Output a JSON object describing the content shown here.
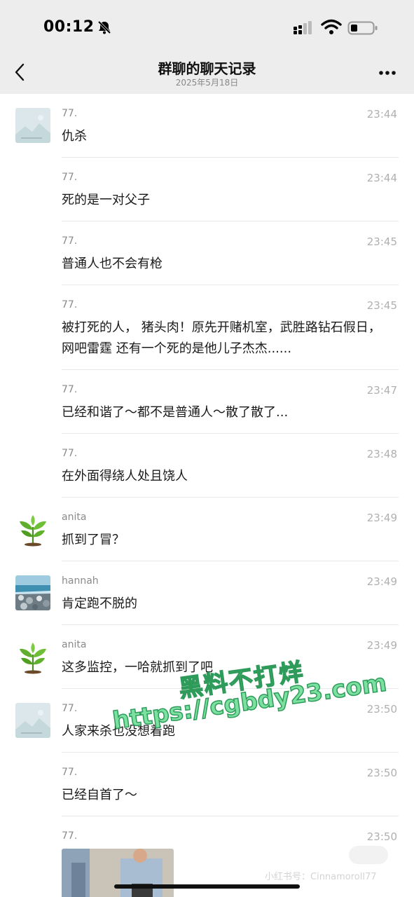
{
  "status_bar": {
    "time": "00:12",
    "bell_icon": "bell-slash-icon",
    "signal_icon": "signal-icon",
    "wifi_icon": "wifi-icon",
    "battery_icon": "battery-low-icon"
  },
  "header": {
    "back_icon": "chevron-left-icon",
    "title": "群聊的聊天记录",
    "date": "2025年5月18日",
    "more_icon": "more-dots-icon"
  },
  "messages": [
    {
      "sender": "77.",
      "time": "23:44",
      "text": "仇杀",
      "avatar": "placeholder",
      "show_avatar": true
    },
    {
      "sender": "77.",
      "time": "23:44",
      "text": "死的是一对父子",
      "show_avatar": false
    },
    {
      "sender": "77.",
      "time": "23:45",
      "text": "普通人也不会有枪",
      "show_avatar": false
    },
    {
      "sender": "77.",
      "time": "23:45",
      "text": "被打死的人， 猪头肉！原先开赌机室，武胜路钻石假日，网吧雷霆 还有一个死的是他儿子杰杰......",
      "show_avatar": false
    },
    {
      "sender": "77.",
      "time": "23:47",
      "text": "已经和谐了～都不是普通人～散了散了...",
      "show_avatar": false
    },
    {
      "sender": "77.",
      "time": "23:48",
      "text": "在外面得绕人处且饶人",
      "show_avatar": false
    },
    {
      "sender": "anita",
      "time": "23:49",
      "text": "抓到了冒？",
      "avatar": "plant",
      "show_avatar": true
    },
    {
      "sender": "hannah",
      "time": "23:49",
      "text": "肯定跑不脱的",
      "avatar": "landscape",
      "show_avatar": true
    },
    {
      "sender": "anita",
      "time": "23:49",
      "text": "这多监控，一哈就抓到了吧",
      "avatar": "plant",
      "show_avatar": true
    },
    {
      "sender": "77.",
      "time": "23:50",
      "text": "人家来杀也没想着跑",
      "avatar": "placeholder",
      "show_avatar": true
    },
    {
      "sender": "77.",
      "time": "23:50",
      "text": "已经自首了～",
      "show_avatar": false
    },
    {
      "sender": "77.",
      "time": "23:50",
      "text": "",
      "has_photo": true,
      "show_avatar": false
    }
  ],
  "watermark": {
    "line1": "黑料不打烊",
    "line2": "https://cgbdy23.com"
  },
  "source_tag": "小红书号：Cinnamoroll77",
  "colors": {
    "nav_bg": "#ededed",
    "body_bg": "#ffffff",
    "watermark_fill": "#7be0a0",
    "watermark_stroke": "#2f9b5a"
  }
}
